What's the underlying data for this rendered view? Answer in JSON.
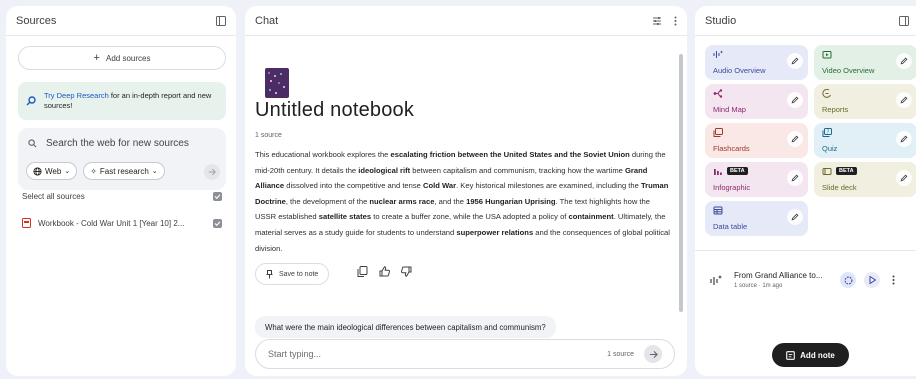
{
  "sources": {
    "title": "Sources",
    "add_label": "Add sources",
    "deep_research_link": "Try Deep Research",
    "deep_research_text": " for an in-depth report and new sources!",
    "search_placeholder": "Search the web for new sources",
    "web_chip": "Web",
    "fast_chip": "Fast research",
    "select_all": "Select all sources",
    "items": [
      {
        "label": "Workbook - Cold War Unit 1 [Year 10] 2...",
        "icon": "pdf-icon",
        "checked": true
      }
    ]
  },
  "chat": {
    "title": "Chat",
    "notebook_title": "Untitled notebook",
    "source_count": "1 source",
    "summary": [
      {
        "t": "This educational workbook explores the "
      },
      {
        "t": "escalating friction between the United States and the Soviet Union",
        "b": true
      },
      {
        "t": " during the mid-20th century. It details the "
      },
      {
        "t": "ideological rift",
        "b": true
      },
      {
        "t": " between capitalism and communism, tracking how the wartime "
      },
      {
        "t": "Grand Alliance",
        "b": true
      },
      {
        "t": " dissolved into the competitive and tense "
      },
      {
        "t": "Cold War",
        "b": true
      },
      {
        "t": ". Key historical milestones are examined, including the "
      },
      {
        "t": "Truman Doctrine",
        "b": true
      },
      {
        "t": ", the development of the "
      },
      {
        "t": "nuclear arms race",
        "b": true
      },
      {
        "t": ", and the "
      },
      {
        "t": "1956 Hungarian Uprising",
        "b": true
      },
      {
        "t": ". The text highlights how the USSR established "
      },
      {
        "t": "satellite states",
        "b": true
      },
      {
        "t": " to create a buffer zone, while the USA adopted a policy of "
      },
      {
        "t": "containment",
        "b": true
      },
      {
        "t": ". Ultimately, the material serves as a study guide for students to understand "
      },
      {
        "t": "superpower relations",
        "b": true
      },
      {
        "t": " and the consequences of global political division."
      }
    ],
    "save_note": "Save to note",
    "suggested_question": "What were the main ideological differences between capitalism and communism?",
    "composer_placeholder": "Start typing...",
    "composer_count": "1 source"
  },
  "studio": {
    "title": "Studio",
    "tiles": [
      {
        "label": "Audio Overview",
        "bg": "#e6e9f7",
        "fg": "#3b4a9c",
        "icon": "waveform-icon",
        "beta": false
      },
      {
        "label": "Video Overview",
        "bg": "#e3f0e5",
        "fg": "#256b37",
        "icon": "video-icon",
        "beta": false
      },
      {
        "label": "Mind Map",
        "bg": "#f3e6f0",
        "fg": "#8a2c6d",
        "icon": "mindmap-icon",
        "beta": false
      },
      {
        "label": "Reports",
        "bg": "#f0efe0",
        "fg": "#6b6a2c",
        "icon": "reports-icon",
        "beta": false
      },
      {
        "label": "Flashcards",
        "bg": "#f9e8e6",
        "fg": "#a03a2c",
        "icon": "flashcards-icon",
        "beta": false
      },
      {
        "label": "Quiz",
        "bg": "#e1f0f7",
        "fg": "#1f6a8c",
        "icon": "quiz-icon",
        "beta": false
      },
      {
        "label": "Infographic",
        "bg": "#f3e6f0",
        "fg": "#8a2c6d",
        "icon": "infographic-icon",
        "beta": true
      },
      {
        "label": "Slide deck",
        "bg": "#f0efe0",
        "fg": "#6b6a2c",
        "icon": "slides-icon",
        "beta": true
      },
      {
        "label": "Data table",
        "bg": "#e6e9f7",
        "fg": "#3b4a9c",
        "icon": "table-icon",
        "beta": false
      }
    ],
    "beta_label": "BETA",
    "generated": {
      "title": "From Grand Alliance to...",
      "meta": "1 source · 1m ago"
    },
    "add_note": "Add note"
  }
}
